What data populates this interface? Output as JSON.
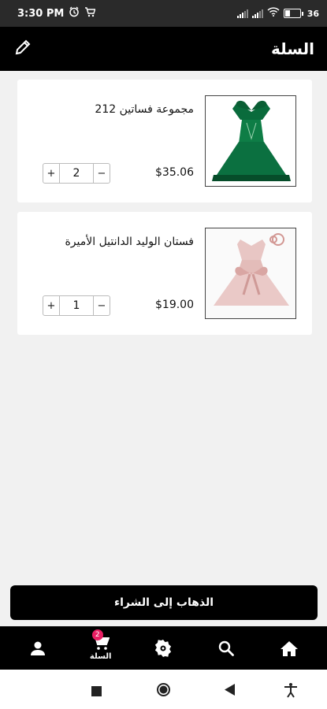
{
  "status_bar": {
    "time": "3:30 PM",
    "battery": "36",
    "icons": [
      "alarm-icon",
      "cart-notification-icon",
      "signal-icon",
      "signal-icon",
      "wifi-icon",
      "battery-icon"
    ]
  },
  "app_bar": {
    "title": "السلة",
    "edit_icon": "pencil-icon"
  },
  "cart": {
    "items": [
      {
        "name": "مجموعة فساتين 212",
        "price": "$35.06",
        "quantity": "2",
        "plus_label": "+",
        "minus_label": "−",
        "image": "green-dress-image"
      },
      {
        "name": "فستان الوليد الدانتيل الأميرة",
        "price": "$19.00",
        "quantity": "1",
        "plus_label": "+",
        "minus_label": "−",
        "image": "pink-dress-image"
      }
    ]
  },
  "checkout": {
    "label": "الذهاب إلى الشراء"
  },
  "bottom_nav": {
    "items": [
      {
        "icon": "person-icon",
        "label": ""
      },
      {
        "icon": "cart-icon",
        "label": "السلة",
        "badge": "2",
        "active": true
      },
      {
        "icon": "settings-gear-icon",
        "label": ""
      },
      {
        "icon": "search-icon",
        "label": ""
      },
      {
        "icon": "home-icon",
        "label": ""
      }
    ]
  },
  "system_nav": {
    "icons": [
      "recents-square-icon",
      "home-circle-icon",
      "back-triangle-icon",
      "accessibility-icon"
    ]
  },
  "colors": {
    "bar": "#000000",
    "background": "#f1f1f1",
    "badge": "#e91e63"
  }
}
